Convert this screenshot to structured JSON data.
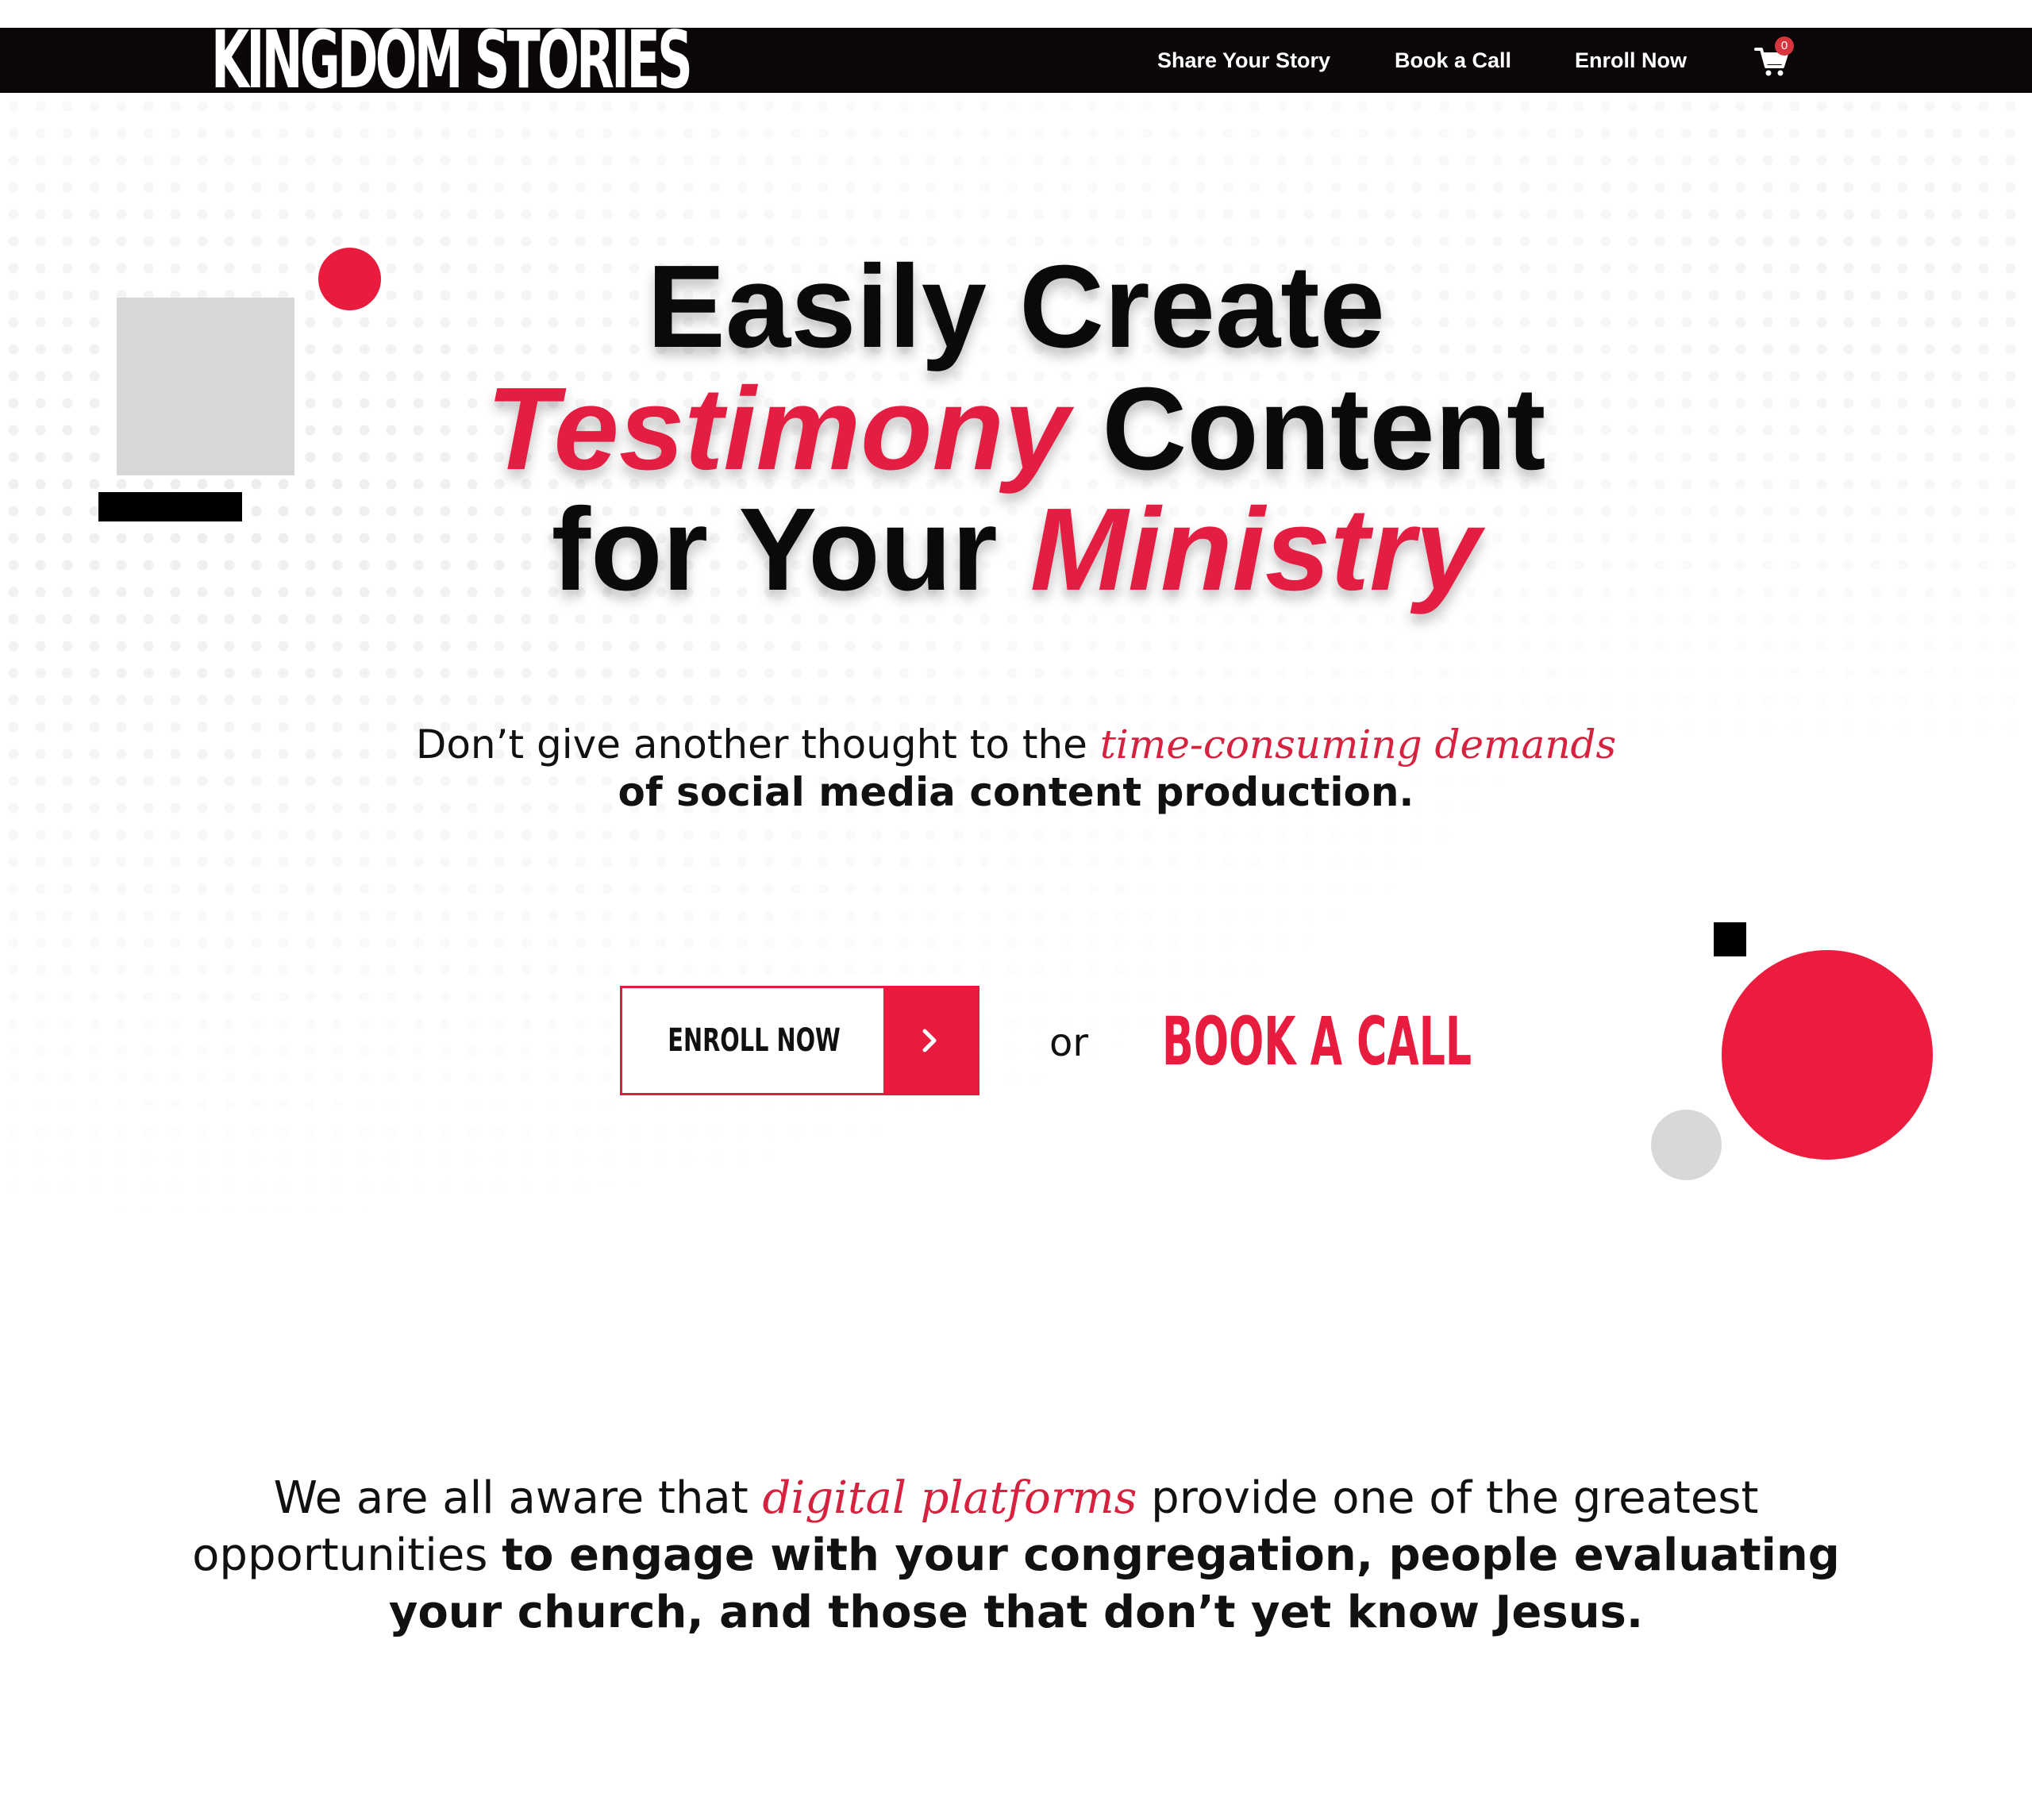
{
  "header": {
    "logo_text": "KINGDOM STORIES",
    "nav": [
      {
        "label": "Share Your Story"
      },
      {
        "label": "Book a Call"
      },
      {
        "label": "Enroll Now"
      }
    ],
    "cart_count": "0"
  },
  "hero": {
    "headline_line1": "Easily Create",
    "headline_line2_accent": "Testimony",
    "headline_line2_rest": "Content",
    "headline_line3_start": "for Your",
    "headline_line3_accent": "Ministry",
    "sub_line1_start": "Don’t give another thought to the",
    "sub_line1_accent": "time-consuming demands",
    "sub_line2": "of social media content production."
  },
  "cta": {
    "enroll_label": "ENROLL NOW",
    "or_text": "or",
    "book_call_label": "BOOK A CALL"
  },
  "intro": {
    "line1_start": "We are all aware that",
    "line1_accent": "digital platforms",
    "line1_end": "provide one of the greatest",
    "line2_start": "opportunities",
    "line2_bold": "to engage with your congregation, people evaluating",
    "line3": "your church, and those that don’t yet know Jesus."
  },
  "colors": {
    "accent_red": "#e91c3f",
    "header_black": "#0b0708",
    "decor_grey": "#d7d7d7"
  },
  "icons": {
    "cart": "shopping-cart-icon",
    "arrow": "chevron-right-icon"
  }
}
